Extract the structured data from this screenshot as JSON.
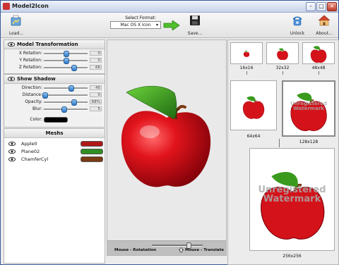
{
  "window": {
    "title": "Model2Icon"
  },
  "toolbar": {
    "load_label": "Load...",
    "format_label": "Select Format:",
    "format_value": "Mac OS X Icon",
    "save_label": "Save...",
    "unlock_label": "Unlock",
    "about_label": "About..."
  },
  "model_transformation": {
    "title": "Model Transformation",
    "rows": [
      {
        "label": "X Rotation:",
        "value": "0",
        "fraction": 0.5
      },
      {
        "label": "Y Rotation:",
        "value": "0",
        "fraction": 0.5
      },
      {
        "label": "Z Rotation:",
        "value": "66",
        "fraction": 0.68
      }
    ]
  },
  "show_shadow": {
    "title": "Show Shadow",
    "rows": [
      {
        "label": "Direction:",
        "value": "45",
        "fraction": 0.62
      },
      {
        "label": "Distance:",
        "value": "0",
        "fraction": 0.02
      },
      {
        "label": "Opacity:",
        "value": "68%",
        "fraction": 0.68
      },
      {
        "label": "Blur:",
        "value": "5",
        "fraction": 0.45
      }
    ],
    "color_label": "Color:",
    "color": "#000000"
  },
  "meshes": {
    "title": "Meshs",
    "items": [
      {
        "name": "Apple0",
        "color": "#b01818"
      },
      {
        "name": "Plane02",
        "color": "#2f8f23"
      },
      {
        "name": "ChamferCyl",
        "color": "#7a3a12"
      }
    ]
  },
  "viewport": {
    "hint_left": "Mouse - Rotatation",
    "hint_right": "Mouse - Translate",
    "zoom_fraction": 0.72
  },
  "icons": {
    "size_16": "16x16",
    "size_32": "32x32",
    "size_48": "48x48",
    "size_64": "64x64",
    "size_128": "128x128",
    "size_256": "256x256",
    "watermark_line1": "Unregistered",
    "watermark_line2": "Watermark"
  },
  "colors": {
    "apple": "#d4121a",
    "leaf": "#3a9a1e",
    "stem": "#7a3a12",
    "accent": "#2b75c5"
  }
}
